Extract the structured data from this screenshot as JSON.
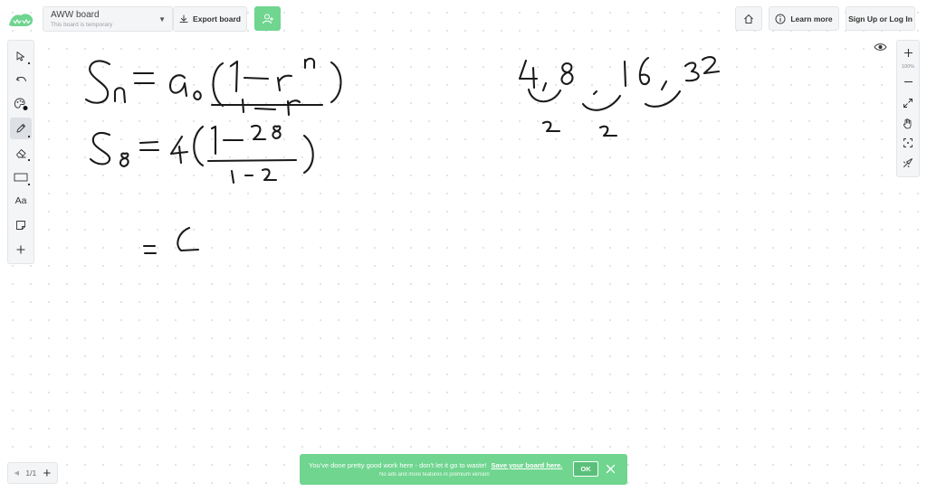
{
  "header": {
    "board_title": "AWW board",
    "board_subtitle": "This board is temporary",
    "export_label": "Export board",
    "learn_more_label": "Learn more",
    "sign_in_label": "Sign Up or Log In"
  },
  "right_toolbar": {
    "zoom_level": "100%"
  },
  "left_toolbar": {
    "text_tool_label": "Aa"
  },
  "pages": {
    "indicator": "1/1"
  },
  "toast": {
    "message": "You've done pretty good work here - don't let it go to waste!",
    "link_label": "Save your board here.",
    "subtext": "No ads and more features in premium version",
    "ok_label": "OK"
  },
  "colors": {
    "accent_green": "#6fd58f",
    "ink": "#1a1a1a",
    "panel_bg": "#f4f5f6"
  }
}
